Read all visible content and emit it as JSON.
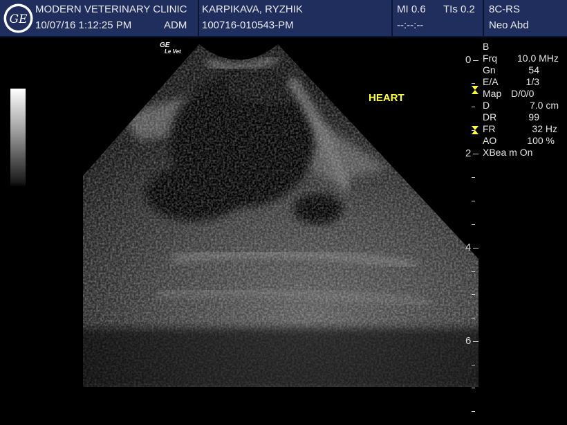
{
  "header": {
    "clinic": "MODERN VETERINARY CLINIC",
    "datetime": "10/07/16 1:12:25 PM",
    "operator": "ADM",
    "patient": "KARPIKAVA, RYZHIK",
    "exam_id": "100716-010543-PM",
    "mi": "MI 0.6",
    "tis": "TIs 0.2",
    "timer": "--:--:--",
    "probe": "8C-RS",
    "preset": "Neo Abd"
  },
  "image": {
    "annotation": "HEART",
    "brand_top": "GE",
    "brand_bottom": "Le Vet",
    "colors": {
      "header_bg": "#1f2e5c",
      "annotation": "#ffff3a",
      "scan_bg": "#000000"
    }
  },
  "params": {
    "mode": "B",
    "rows": [
      {
        "label": "Frq",
        "value": "10.0 MHz"
      },
      {
        "label": "Gn",
        "value": "54"
      },
      {
        "label": "E/A",
        "value": "1/3"
      },
      {
        "label": "Map",
        "value": "D/0/0"
      },
      {
        "label": "D",
        "value": "7.0 cm"
      },
      {
        "label": "DR",
        "value": "99"
      },
      {
        "label": "FR",
        "value": "32 Hz"
      },
      {
        "label": "AO",
        "value": "100 %"
      },
      {
        "label": "XBea m On",
        "value": ""
      }
    ]
  },
  "depth_scale": {
    "labels": [
      "0",
      "2",
      "4",
      "6"
    ]
  }
}
